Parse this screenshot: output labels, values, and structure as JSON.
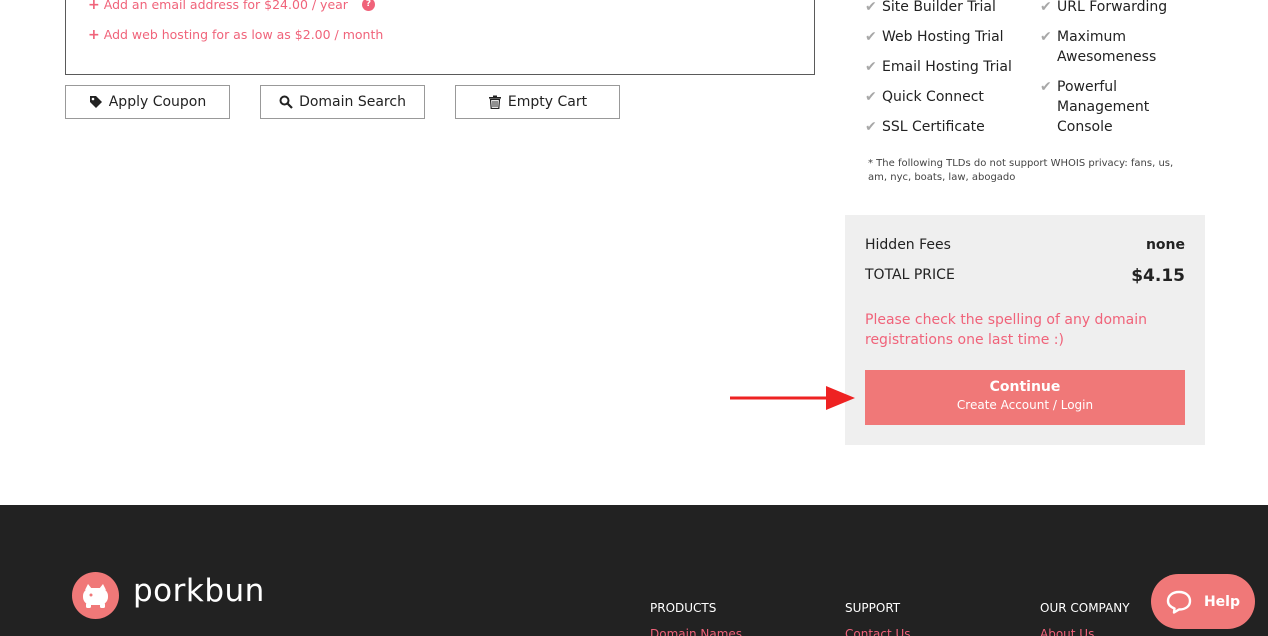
{
  "addons": {
    "email": "Add an email address for $24.00 / year",
    "hosting": "Add web hosting for as low as $2.00 / month"
  },
  "cart_buttons": {
    "apply_coupon": "Apply Coupon",
    "domain_search": "Domain Search",
    "empty_cart": "Empty Cart"
  },
  "features": {
    "left": [
      "Site Builder Trial",
      "Web Hosting Trial",
      "Email Hosting Trial",
      "Quick Connect",
      "SSL Certificate"
    ],
    "right": [
      "URL Forwarding",
      "Maximum Awesomeness",
      "Powerful Management Console"
    ]
  },
  "whois_note": "* The following TLDs do not support WHOIS privacy: fans, us, am, nyc, boats, law, abogado",
  "summary": {
    "hidden_fees_label": "Hidden Fees",
    "hidden_fees_value": "none",
    "total_label": "TOTAL PRICE",
    "total_value": "$4.15",
    "spelling_notice": "Please check the spelling of any domain registrations one last time :)",
    "continue_label": "Continue",
    "continue_sub": "Create Account / Login"
  },
  "footer": {
    "brand": "porkbun",
    "columns": [
      {
        "heading": "PRODUCTS",
        "link": "Domain Names"
      },
      {
        "heading": "SUPPORT",
        "link": "Contact Us"
      },
      {
        "heading": "OUR COMPANY",
        "link": "About Us"
      }
    ]
  },
  "help_label": "Help",
  "colors": {
    "accent": "#f0637a",
    "button": "#f07878",
    "arrow": "#ee2222",
    "footer_bg": "#222222",
    "summary_bg": "#efefef"
  },
  "icons": [
    "plus-icon",
    "question-icon",
    "tag-icon",
    "search-icon",
    "trash-icon",
    "check-icon",
    "arrow-icon",
    "pig-logo-icon",
    "chat-icon"
  ]
}
